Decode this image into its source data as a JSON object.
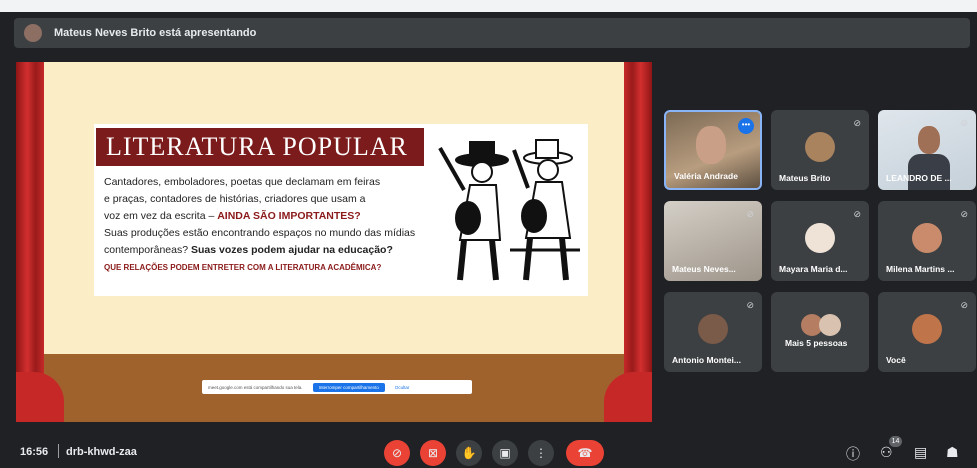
{
  "presenter": {
    "text": "Mateus Neves Brito está apresentando"
  },
  "slide": {
    "title": "LITERATURA POPULAR",
    "line1": "Cantadores, emboladores, poetas que declamam em feiras",
    "line2": "e praças, contadores de histórias, criadores que usam a",
    "line3a": "voz em vez da escrita – ",
    "line3b": "AINDA SÃO IMPORTANTES?",
    "line4": "Suas produções estão encontrando espaços no mundo das mídias",
    "line5a": "contemporâneas? ",
    "line5b": "Suas vozes podem ajudar na educação?",
    "line6": "QUE RELAÇÕES PODEM ENTRETER COM A LITERATURA ACADÊMICA?"
  },
  "share_notice": {
    "text": "meet.google.com está compartilhando sua tela.",
    "stop_label": "Interromper compartilhamento",
    "hide_label": "Ocultar"
  },
  "participants": [
    {
      "name": "Valéria Andrade"
    },
    {
      "name": "Mateus Brito"
    },
    {
      "name": "LEANDRO DE ..."
    },
    {
      "name": "Mateus Neves..."
    },
    {
      "name": "Mayara Maria d..."
    },
    {
      "name": "Milena Martins ..."
    },
    {
      "name": "Antonio Montei..."
    },
    {
      "name": "Mais 5 pessoas"
    },
    {
      "name": "Você"
    }
  ],
  "meeting": {
    "time": "16:56",
    "code": "drb-khwd-zaa",
    "participant_count": "14"
  },
  "icons": [
    "mic-off-icon",
    "camera-off-icon",
    "raise-hand-icon",
    "present-icon",
    "more-options-icon",
    "end-call-icon",
    "info-icon",
    "people-icon",
    "chat-icon",
    "activities-icon"
  ]
}
